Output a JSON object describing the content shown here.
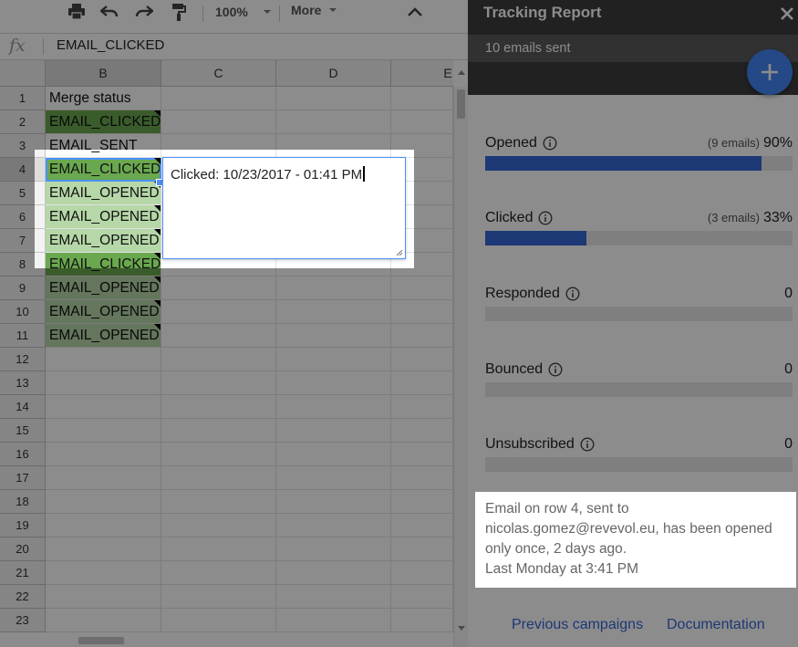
{
  "toolbar": {
    "zoom": "100%",
    "more_label": "More"
  },
  "formula_bar": {
    "fx_label": "fx",
    "value": "EMAIL_CLICKED"
  },
  "columns": [
    "B",
    "C",
    "D",
    "E"
  ],
  "rows": [
    {
      "num": "1",
      "b": "Merge status",
      "fill": "none"
    },
    {
      "num": "2",
      "b": "EMAIL_CLICKED",
      "fill": "dark"
    },
    {
      "num": "3",
      "b": "EMAIL_SENT",
      "fill": "none"
    },
    {
      "num": "4",
      "b": "EMAIL_CLICKED",
      "fill": "dark"
    },
    {
      "num": "5",
      "b": "EMAIL_OPENED",
      "fill": "light"
    },
    {
      "num": "6",
      "b": "EMAIL_OPENED",
      "fill": "light"
    },
    {
      "num": "7",
      "b": "EMAIL_OPENED",
      "fill": "light"
    },
    {
      "num": "8",
      "b": "EMAIL_CLICKED",
      "fill": "dark"
    },
    {
      "num": "9",
      "b": "EMAIL_OPENED",
      "fill": "light"
    },
    {
      "num": "10",
      "b": "EMAIL_OPENED",
      "fill": "light"
    },
    {
      "num": "11",
      "b": "EMAIL_OPENED",
      "fill": "light"
    },
    {
      "num": "12",
      "b": "",
      "fill": "none"
    },
    {
      "num": "13",
      "b": "",
      "fill": "none"
    },
    {
      "num": "14",
      "b": "",
      "fill": "none"
    },
    {
      "num": "15",
      "b": "",
      "fill": "none"
    },
    {
      "num": "16",
      "b": "",
      "fill": "none"
    },
    {
      "num": "17",
      "b": "",
      "fill": "none"
    },
    {
      "num": "18",
      "b": "",
      "fill": "none"
    },
    {
      "num": "19",
      "b": "",
      "fill": "none"
    },
    {
      "num": "20",
      "b": "",
      "fill": "none"
    },
    {
      "num": "21",
      "b": "",
      "fill": "none"
    },
    {
      "num": "22",
      "b": "",
      "fill": "none"
    },
    {
      "num": "23",
      "b": "",
      "fill": "none"
    }
  ],
  "note": {
    "text": "Clicked: 10/23/2017 - 01:41 PM"
  },
  "sidebar": {
    "title": "Tracking Report",
    "subtitle": "10 emails sent",
    "metrics": [
      {
        "label": "Opened",
        "count": "(9 emails)",
        "value": "90%",
        "fraction": 0.9
      },
      {
        "label": "Clicked",
        "count": "(3 emails)",
        "value": "33%",
        "fraction": 0.33
      },
      {
        "label": "Responded",
        "count": "",
        "value": "0",
        "fraction": 0
      },
      {
        "label": "Bounced",
        "count": "",
        "value": "0",
        "fraction": 0
      },
      {
        "label": "Unsubscribed",
        "count": "",
        "value": "0",
        "fraction": 0
      }
    ],
    "message": {
      "line1": "Email on row 4, sent to",
      "line2": "nicolas.gomez@revevol.eu, has been opened",
      "line3": "only once, 2 days ago.",
      "line4": "Last Monday at 3:41 PM"
    },
    "footer": {
      "previous_campaigns": "Previous campaigns",
      "documentation": "Documentation"
    }
  },
  "colors": {
    "fill_dark": "#6aa84f",
    "fill_light": "#b6d7a8",
    "accent": "#3367d6",
    "fab": "#4285f4"
  },
  "icons": [
    "print-icon",
    "undo-icon",
    "redo-icon",
    "paint-format-icon",
    "chevron-down-icon",
    "chevron-up-icon",
    "close-icon",
    "plus-icon",
    "info-icon"
  ]
}
